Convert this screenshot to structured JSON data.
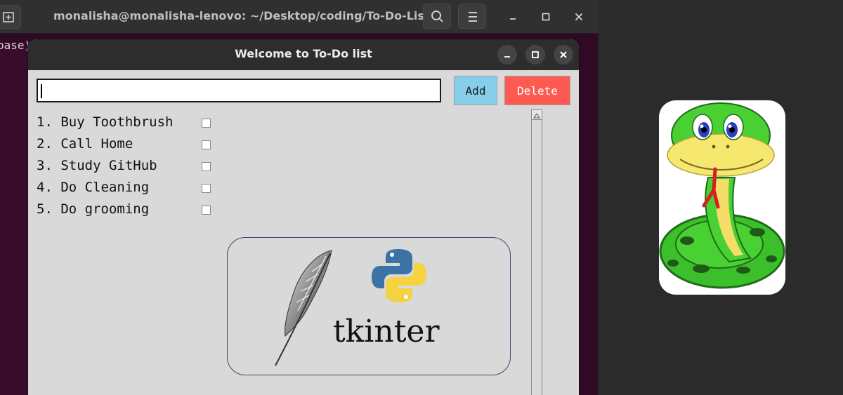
{
  "terminal": {
    "title": "monalisha@monalisha-lenovo: ~/Desktop/coding/To-Do-List",
    "prompt_fragment": "base)"
  },
  "dialog": {
    "title": "Welcome to To-Do list",
    "entry_value": "",
    "add_label": "Add",
    "delete_label": "Delete",
    "tasks": [
      {
        "text": "1. Buy Toothbrush"
      },
      {
        "text": "2. Call Home"
      },
      {
        "text": "3. Study GitHub"
      },
      {
        "text": "4. Do Cleaning"
      },
      {
        "text": "5. Do grooming"
      }
    ],
    "logo_text": "tkinter"
  },
  "colors": {
    "add_button": "#87ceeb",
    "delete_button": "#ff5a52",
    "dialog_bg": "#d9d9d9",
    "terminal_bg": "#300a24"
  },
  "icons": {
    "search": "search-icon",
    "menu": "hamburger-menu-icon",
    "new_tab": "new-tab-icon",
    "minimize": "minimize-icon",
    "maximize": "maximize-icon",
    "close": "close-icon",
    "feather": "feather-logo",
    "python": "python-logo",
    "snake": "snake-illustration"
  }
}
